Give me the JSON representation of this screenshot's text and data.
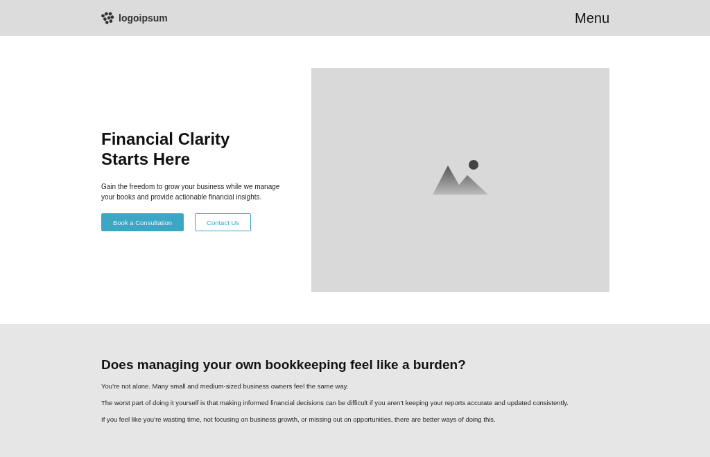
{
  "header": {
    "logo": "logoipsum",
    "menu": "Menu"
  },
  "hero": {
    "title_lines": [
      "Financial Clarity",
      "Starts Here"
    ],
    "text": "Gain the freedom to grow your business while we manage your books and provide actionable financial insights.",
    "buttons": [
      {
        "label": "Book a Consultation",
        "kind": "primary"
      },
      {
        "label": "Contact Us",
        "kind": "outline"
      }
    ],
    "image": {
      "kind": "picture"
    }
  },
  "section": {
    "title": "Does managing your own bookkeeping feel like a burden?",
    "paragraphs": [
      "You’re not alone. Many small and medium-sized business owners feel the same way.",
      "The worst part of doing it yourself is that making informed financial decisions can be difficult if you aren’t keeping your reports accurate and updated consistently.",
      "If you feel like you’re wasting time, not focusing on business growth, or missing out on opportunities, there are better ways of doing this."
    ]
  }
}
